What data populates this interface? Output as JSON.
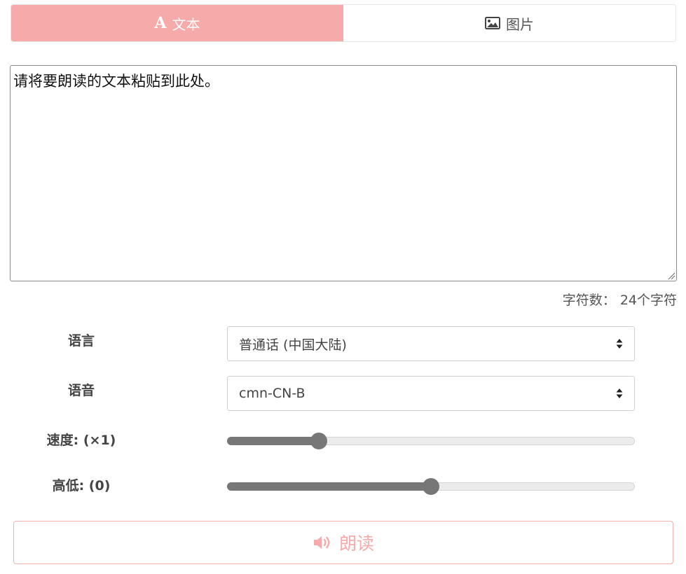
{
  "tabs": [
    {
      "label": "文本",
      "icon": "font-icon",
      "active": true
    },
    {
      "label": "图片",
      "icon": "image-icon",
      "active": false
    }
  ],
  "text_input": {
    "value": "请将要朗读的文本粘贴到此处。"
  },
  "char_count": {
    "text": "字符数： 24个字符"
  },
  "language": {
    "label": "语言",
    "selected": "普通话 (中国大陆)"
  },
  "voice": {
    "label": "语音",
    "selected": "cmn-CN-B"
  },
  "speed": {
    "label": "速度: (×1)",
    "fraction": 0.225
  },
  "pitch": {
    "label": "高低: (0)",
    "fraction": 0.5
  },
  "read_button": {
    "label": "朗读",
    "icon": "volume-icon"
  },
  "colors": {
    "accent": "#f7aaaa",
    "slider": "#777777"
  }
}
